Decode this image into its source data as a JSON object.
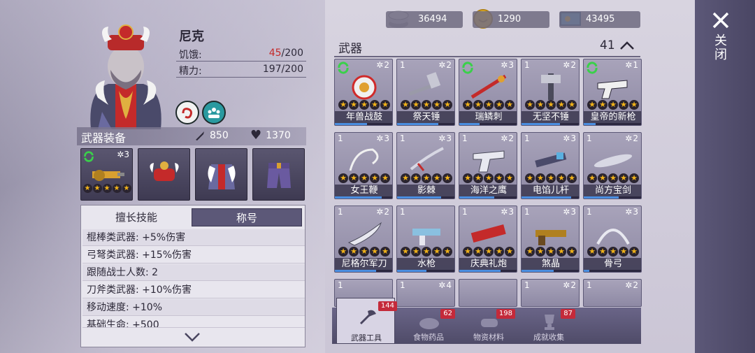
{
  "character": {
    "name": "尼克",
    "hunger_label": "饥饿:",
    "hunger_current": "45",
    "hunger_max": "/200",
    "energy_label": "精力:",
    "energy_value": "197/200"
  },
  "equipment": {
    "title": "武器装备",
    "attack": "850",
    "health": "1370",
    "weapon_slot_count": "3",
    "weapon_slot_stars": 5
  },
  "skills": {
    "tab_skills": "擅长技能",
    "tab_titles": "称号",
    "lines": [
      "棍棒类武器: +5%伤害",
      "弓弩类武器: +15%伤害",
      "跟随战士人数: 2",
      "刀斧类武器: +10%伤害",
      "移动速度: +10%",
      "基础生命: +500"
    ]
  },
  "currency": {
    "silver": "36494",
    "gold": "1290",
    "tickets": "43495"
  },
  "weapons": {
    "title": "武器",
    "count": "41",
    "items": [
      {
        "name": "年兽战鼓",
        "level": "",
        "count": "2",
        "refresh": true,
        "progress": 0.55
      },
      {
        "name": "祭天锤",
        "level": "1",
        "count": "2",
        "refresh": false,
        "progress": 0.7
      },
      {
        "name": "瑞鳞刺",
        "level": "",
        "count": "3",
        "refresh": true,
        "progress": 0.35
      },
      {
        "name": "无坚不锤",
        "level": "1",
        "count": "2",
        "refresh": false,
        "progress": 0.65
      },
      {
        "name": "皇帝的新枪",
        "level": "",
        "count": "1",
        "refresh": true,
        "progress": 0.2
      },
      {
        "name": "女王鞭",
        "level": "1",
        "count": "3",
        "refresh": false,
        "progress": 0.8
      },
      {
        "name": "影棘",
        "level": "1",
        "count": "3",
        "refresh": false,
        "progress": 0.75
      },
      {
        "name": "海洋之鹰",
        "level": "1",
        "count": "2",
        "refresh": false,
        "progress": 0.6
      },
      {
        "name": "电馅儿杆",
        "level": "1",
        "count": "3",
        "refresh": false,
        "progress": 0.85
      },
      {
        "name": "尚方宝剑",
        "level": "1",
        "count": "2",
        "refresh": false,
        "progress": 0.6
      },
      {
        "name": "尼格尔军刀",
        "level": "1",
        "count": "2",
        "refresh": false,
        "progress": 0.7
      },
      {
        "name": "水枪",
        "level": "1",
        "count": "",
        "refresh": false,
        "progress": 0.5
      },
      {
        "name": "庆典礼炮",
        "level": "1",
        "count": "3",
        "refresh": false,
        "progress": 0.7
      },
      {
        "name": "煞晶",
        "level": "1",
        "count": "3",
        "refresh": false,
        "progress": 0.55
      },
      {
        "name": "骨弓",
        "level": "1",
        "count": "3",
        "refresh": false,
        "progress": 0.1
      },
      {
        "name": "",
        "level": "1",
        "count": "",
        "refresh": false,
        "progress": 0
      },
      {
        "name": "",
        "level": "1",
        "count": "4",
        "refresh": false,
        "progress": 0
      },
      {
        "name": "",
        "level": "",
        "count": "",
        "refresh": false,
        "progress": 0
      },
      {
        "name": "",
        "level": "1",
        "count": "2",
        "refresh": false,
        "progress": 0
      },
      {
        "name": "",
        "level": "1",
        "count": "2",
        "refresh": false,
        "progress": 0
      }
    ]
  },
  "bottom_tabs": [
    {
      "label": "武器工具",
      "badge": "144"
    },
    {
      "label": "食物药品",
      "badge": "62"
    },
    {
      "label": "物资材料",
      "badge": "198"
    },
    {
      "label": "成就收集",
      "badge": "87"
    }
  ],
  "close_label": "关闭",
  "colors": {
    "accent": "#5c5878",
    "star": "#f0b21a",
    "alert": "#c42a2a"
  }
}
